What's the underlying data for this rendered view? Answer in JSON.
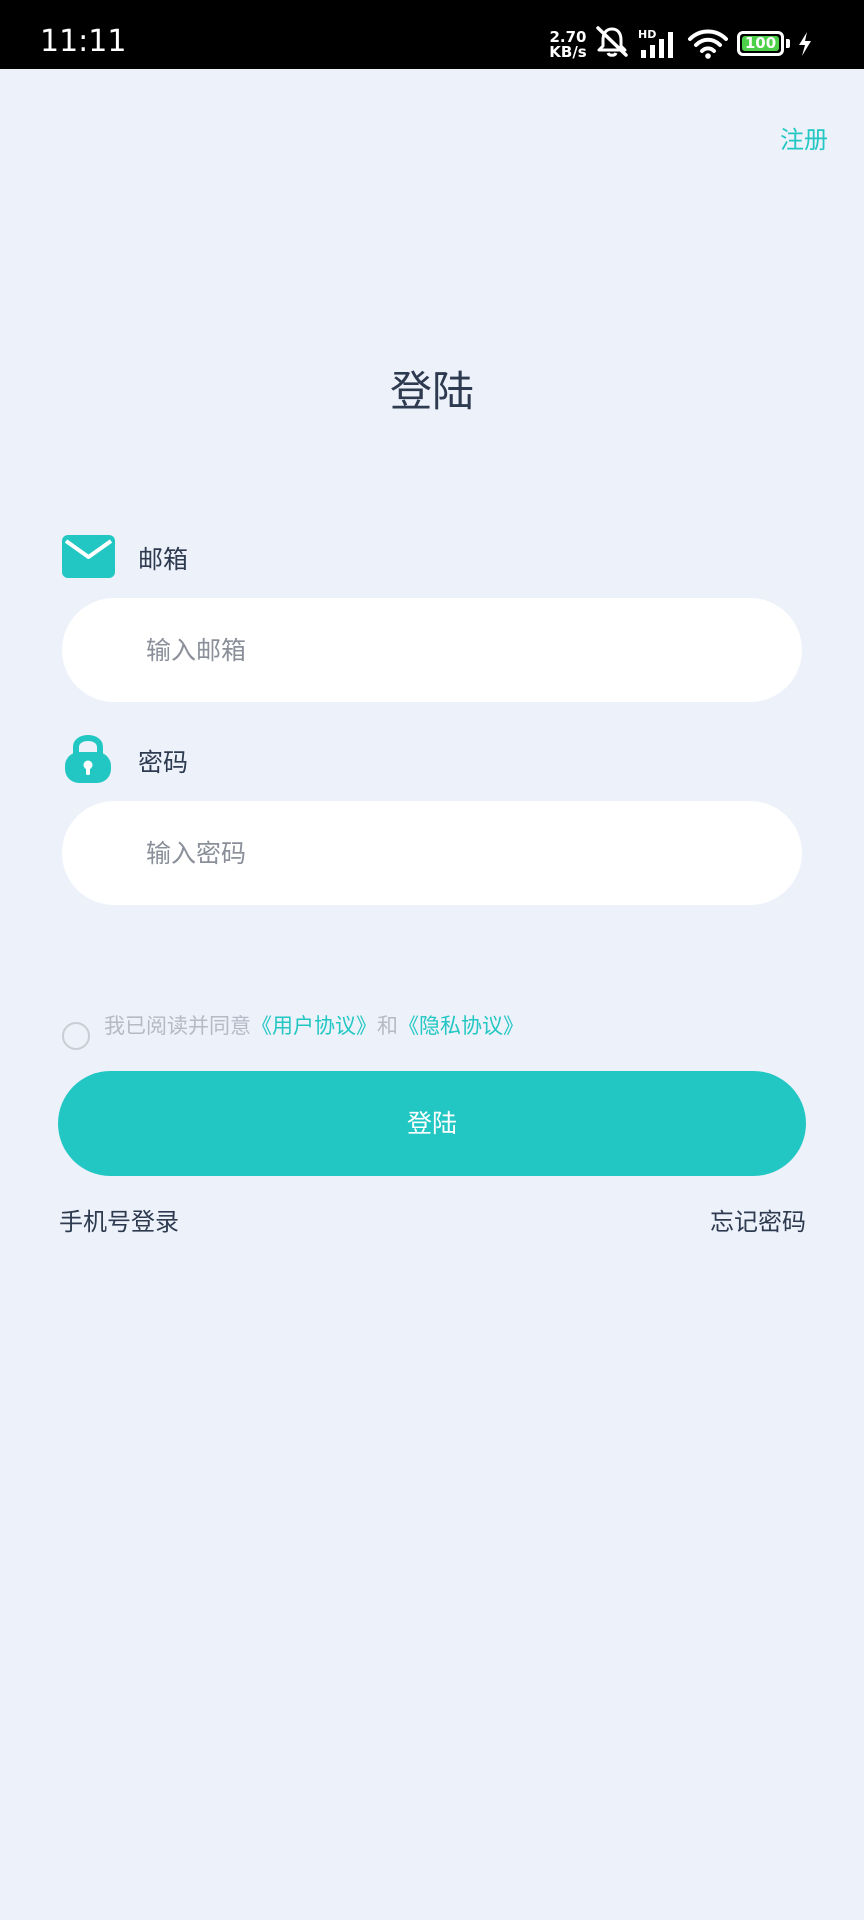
{
  "status_bar": {
    "time": "11:11",
    "net_speed_value": "2.70",
    "net_speed_unit": "KB/s",
    "network_type": "HD",
    "battery_level": "100",
    "battery_color": "#4cd04a"
  },
  "header": {
    "register_label": "注册"
  },
  "page": {
    "title": "登陆"
  },
  "email": {
    "label": "邮箱",
    "placeholder": "输入邮箱",
    "value": "",
    "icon": "mail-icon"
  },
  "password": {
    "label": "密码",
    "placeholder": "输入密码",
    "value": "",
    "icon": "lock-icon"
  },
  "agreement": {
    "checked": false,
    "prefix": "我已阅读并同意",
    "user_agreement": "《用户协议》",
    "conjunction": "和",
    "privacy_policy": "《隐私协议》"
  },
  "login_button": {
    "label": "登陆"
  },
  "footer": {
    "phone_login": "手机号登录",
    "forgot_password": "忘记密码"
  },
  "colors": {
    "accent": "#22c7c3",
    "background": "#ecf1fa",
    "text": "#2d3a4f",
    "muted": "#b5bac4"
  }
}
